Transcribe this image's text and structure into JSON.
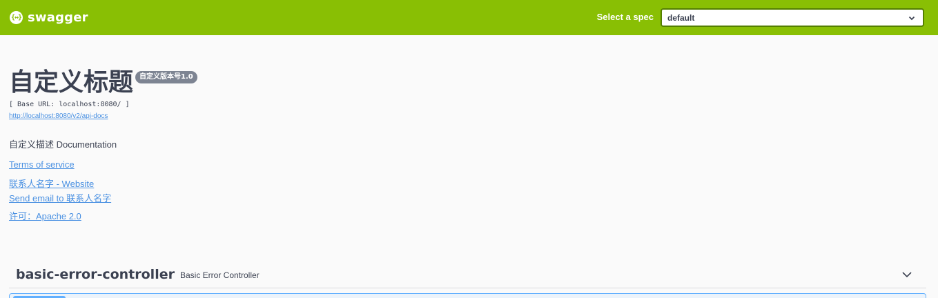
{
  "topbar": {
    "logo_glyph": "{↔}",
    "brand_name": "swagger",
    "spec_label": "Select a spec",
    "spec_value": "default",
    "background_color": "#89bf04"
  },
  "info": {
    "title": "自定义标题",
    "version": "自定义版本号1.0",
    "base_url": "[ Base URL: localhost:8080/ ]",
    "docs_url": "http://localhost:8080/v2/api-docs",
    "description": "自定义描述 Documentation",
    "links": {
      "terms": "Terms of service",
      "website": "联系人名字 - Website",
      "email": "Send email to 联系人名字",
      "license": "许可：Apache 2.0"
    },
    "link_color": "#4990e2"
  },
  "tags": [
    {
      "name": "basic-error-controller",
      "description": "Basic Error Controller"
    }
  ],
  "icons": {
    "select_chevron": "chevron-down-icon",
    "tag_toggle": "chevron-down-icon"
  }
}
